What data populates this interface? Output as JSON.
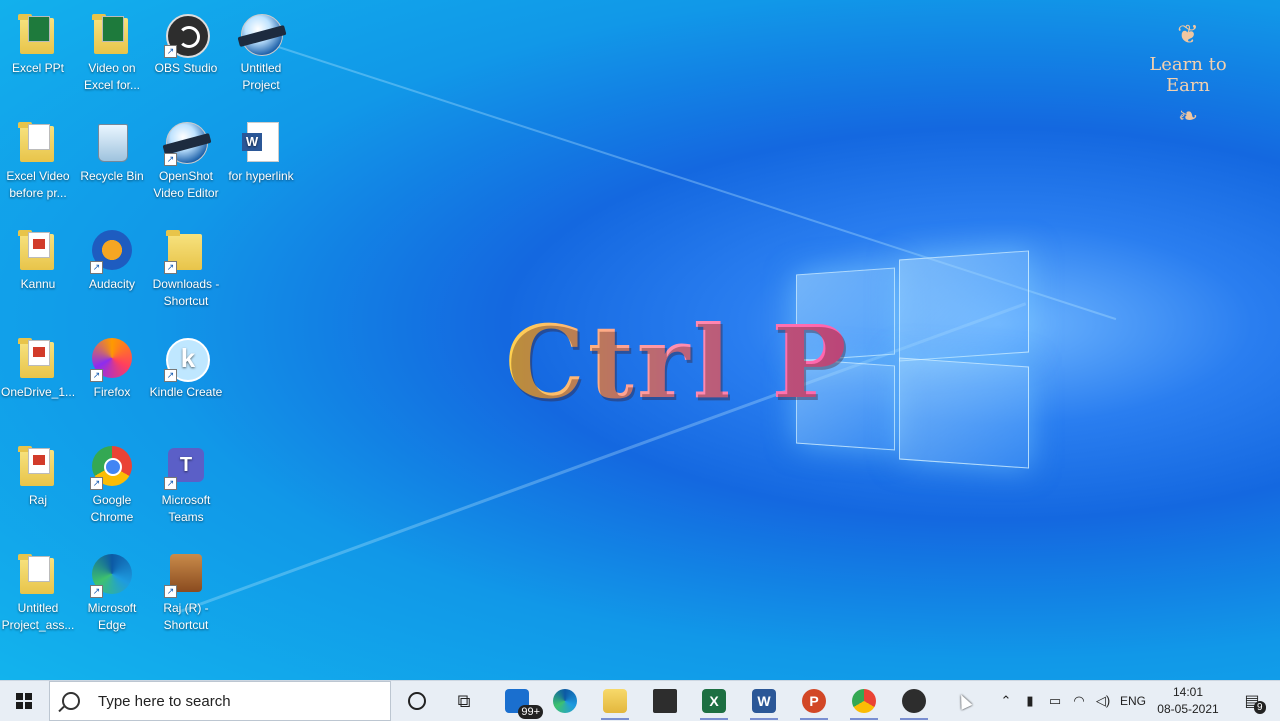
{
  "desktop": {
    "icons": [
      {
        "label": "Excel PPt",
        "icon": "folder-icon"
      },
      {
        "label": "Video on Excel for...",
        "icon": "folder-icon"
      },
      {
        "label": "OBS Studio",
        "icon": "obs-studio-icon"
      },
      {
        "label": "Untitled Project",
        "icon": "openshot-project-icon"
      },
      {
        "label": "Excel Video before pr...",
        "icon": "folder-icon"
      },
      {
        "label": "Recycle Bin",
        "icon": "recycle-bin-icon"
      },
      {
        "label": "OpenShot Video Editor",
        "icon": "openshot-icon"
      },
      {
        "label": "for hyperlink",
        "icon": "word-document-icon"
      },
      {
        "label": "Kannu",
        "icon": "folder-icon"
      },
      {
        "label": "Audacity",
        "icon": "audacity-icon"
      },
      {
        "label": "Downloads - Shortcut",
        "icon": "folder-shortcut-icon"
      },
      {
        "label": "OneDrive_1...",
        "icon": "folder-icon"
      },
      {
        "label": "Firefox",
        "icon": "firefox-icon"
      },
      {
        "label": "Kindle Create",
        "icon": "kindle-create-icon"
      },
      {
        "label": "Raj",
        "icon": "folder-icon"
      },
      {
        "label": "Google Chrome",
        "icon": "chrome-icon"
      },
      {
        "label": "Microsoft Teams",
        "icon": "teams-icon"
      },
      {
        "label": "Untitled Project_ass...",
        "icon": "folder-icon"
      },
      {
        "label": "Microsoft Edge",
        "icon": "edge-icon"
      },
      {
        "label": "Raj (R) - Shortcut",
        "icon": "drive-shortcut-icon"
      }
    ],
    "overlay_text": "Ctrl P",
    "brand": "Learn to Earn"
  },
  "taskbar": {
    "search_placeholder": "Type here to search",
    "mail_badge": "99+",
    "excel_letter": "X",
    "word_letter": "W",
    "ppt_letter": "P",
    "language": "ENG",
    "time": "14:01",
    "date": "08-05-2021",
    "notification_count": "9"
  }
}
